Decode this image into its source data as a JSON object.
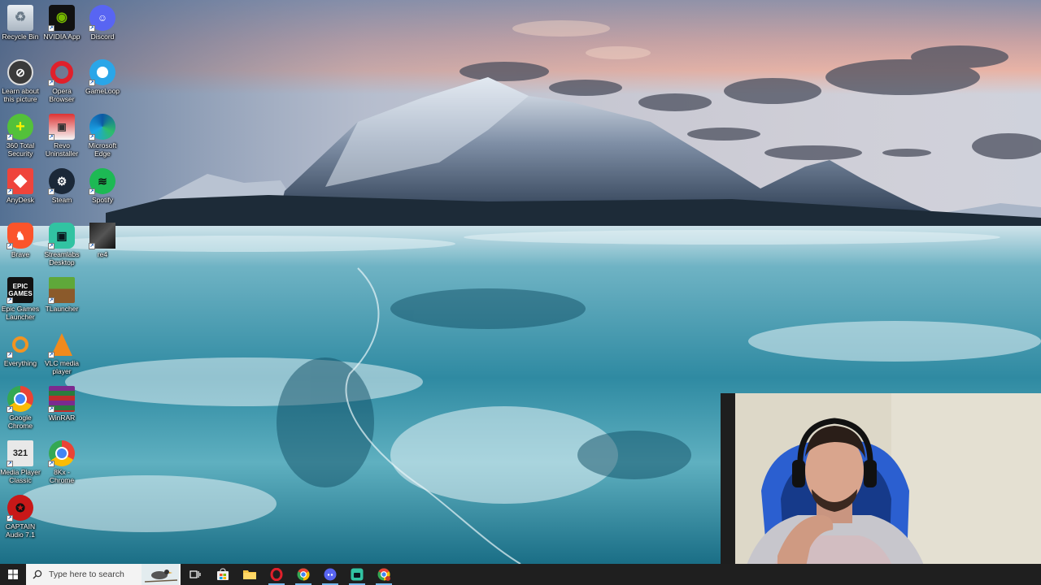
{
  "desktop": {
    "icons": [
      {
        "label": "Recycle Bin"
      },
      {
        "label": "NVIDIA App"
      },
      {
        "label": "Discord"
      },
      {
        "label": "Learn about this picture"
      },
      {
        "label": "Opera Browser"
      },
      {
        "label": "GameLoop"
      },
      {
        "label": "360 Total Security"
      },
      {
        "label": "Revo Uninstaller"
      },
      {
        "label": "Microsoft Edge"
      },
      {
        "label": "AnyDesk"
      },
      {
        "label": "Steam"
      },
      {
        "label": "Spotify"
      },
      {
        "label": "Brave"
      },
      {
        "label": "Streamlabs Desktop"
      },
      {
        "label": "re4"
      },
      {
        "label": "Epic Games Launcher"
      },
      {
        "label": "TLauncher"
      },
      {
        "label": "Everything"
      },
      {
        "label": "VLC media player"
      },
      {
        "label": "Google Chrome"
      },
      {
        "label": "WinRAR"
      },
      {
        "label": "Media Player Classic"
      },
      {
        "label": "8Kx - Chrome"
      },
      {
        "label": "CAPTAIN Audio 7.1"
      }
    ]
  },
  "taskbar": {
    "search_placeholder": "Type here to search",
    "pinned": [
      "start-icon",
      "task-view-icon",
      "microsoft-store-icon",
      "file-explorer-icon",
      "opera-icon",
      "chrome-icon",
      "discord-icon",
      "streamlabs-icon",
      "chrome-profile-icon"
    ]
  }
}
